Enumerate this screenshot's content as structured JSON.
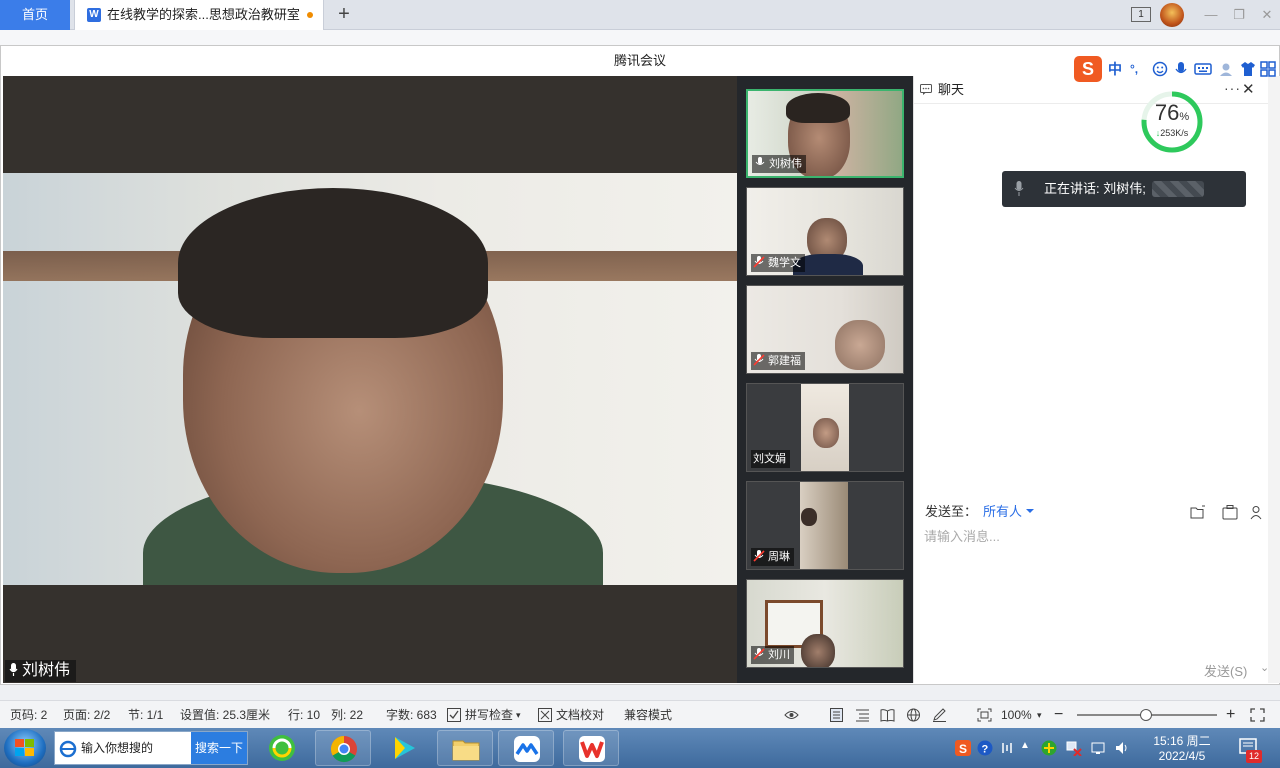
{
  "wps": {
    "home_tab": "首页",
    "doc_tab_title": "在线教学的探索...思想政治教研室",
    "badge": "1"
  },
  "meeting": {
    "window_title": "腾讯会议",
    "main_speaker": "刘树伟",
    "participants": [
      {
        "name": "刘树伟",
        "mic": "on"
      },
      {
        "name": "魏学文",
        "mic": "muted"
      },
      {
        "name": "郭建福",
        "mic": "muted"
      },
      {
        "name": "刘文娟",
        "mic": "none"
      },
      {
        "name": "周琳",
        "mic": "muted"
      },
      {
        "name": "刘川",
        "mic": "muted"
      }
    ]
  },
  "chat": {
    "title": "聊天",
    "speaking_prefix": "正在讲话: 刘树伟;",
    "network_percent": "76",
    "network_percent_unit": "%",
    "network_speed": "253K/s",
    "send_to_label": "发送至：",
    "send_to_target": "所有人",
    "input_placeholder": "请输入消息...",
    "send_button": "发送(S)"
  },
  "ime": {
    "lang": "中",
    "punct": "°,"
  },
  "status_bar": {
    "page_code": "页码: 2",
    "page": "页面: 2/2",
    "section": "节: 1/1",
    "setting": "设置值: 25.3厘米",
    "row": "行: 10",
    "col": "列: 22",
    "word_count": "字数: 683",
    "spellcheck": "拼写检查",
    "proofread": "文档校对",
    "compat": "兼容模式",
    "zoom": "100%",
    "zoom_level": 1.0
  },
  "taskbar": {
    "search_placeholder": "输入你想搜的",
    "search_button": "搜索一下",
    "time": "15:16 周二",
    "date": "2022/4/5",
    "notif_count": "12"
  }
}
